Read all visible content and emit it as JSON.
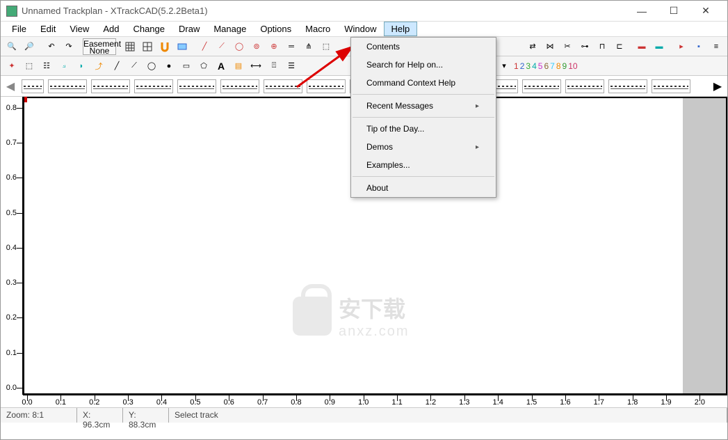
{
  "title": "Unnamed Trackplan - XTrackCAD(5.2.2Beta1)",
  "menubar": [
    "File",
    "Edit",
    "View",
    "Add",
    "Change",
    "Draw",
    "Manage",
    "Options",
    "Macro",
    "Window",
    "Help"
  ],
  "easement": {
    "line1": "Easement",
    "line2": "None"
  },
  "layers": [
    "1",
    "2",
    "3",
    "4",
    "5",
    "6",
    "7",
    "8",
    "9",
    "10"
  ],
  "help_menu": [
    {
      "label": "Contents",
      "sub": false
    },
    {
      "label": "Search for Help on...",
      "sub": false
    },
    {
      "label": "Command Context Help",
      "sub": false
    },
    {
      "sep": true
    },
    {
      "label": "Recent Messages",
      "sub": true
    },
    {
      "sep": true
    },
    {
      "label": "Tip of the Day...",
      "sub": false
    },
    {
      "label": "Demos",
      "sub": true
    },
    {
      "label": "Examples...",
      "sub": false
    },
    {
      "sep": true
    },
    {
      "label": "About",
      "sub": false
    }
  ],
  "ruler_y": [
    "0.0",
    "0.1",
    "0.2",
    "0.3",
    "0.4",
    "0.5",
    "0.6",
    "0.7",
    "0.8"
  ],
  "ruler_x": [
    "0.0",
    "0.1",
    "0.2",
    "0.3",
    "0.4",
    "0.5",
    "0.6",
    "0.7",
    "0.8",
    "0.9",
    "1.0",
    "1.1",
    "1.2",
    "1.3",
    "1.4",
    "1.5",
    "1.6",
    "1.7",
    "1.8",
    "1.9",
    "2.0"
  ],
  "status": {
    "zoom": "Zoom: 8:1",
    "x": "X: 96.3cm",
    "y": "Y: 88.3cm",
    "msg": "Select track"
  },
  "watermark": {
    "cn": "安下载",
    "en": "anxz.com"
  }
}
